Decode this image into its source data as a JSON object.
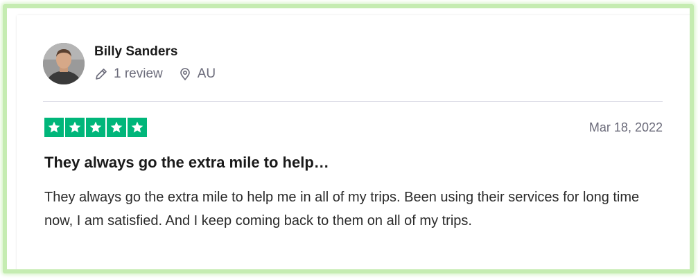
{
  "reviewer": {
    "name": "Billy Sanders",
    "review_count": "1 review",
    "country": "AU",
    "avatar_icon": "person-photo"
  },
  "rating": {
    "stars": 5,
    "max_stars": 5,
    "color": "#00b67a"
  },
  "review": {
    "date": "Mar 18, 2022",
    "title": "They always go the extra mile to help…",
    "body": "They always go the extra mile to help me in all of my trips. Been using their services for long time now, I am satisfied. And I keep coming back to them on all of my trips."
  },
  "icons": {
    "review_count": "pencil-icon",
    "country": "location-pin-icon",
    "star": "star-icon"
  },
  "colors": {
    "frame_border": "#c5ecb1",
    "meta_text": "#6b6b7a",
    "divider": "#dcdce6"
  }
}
